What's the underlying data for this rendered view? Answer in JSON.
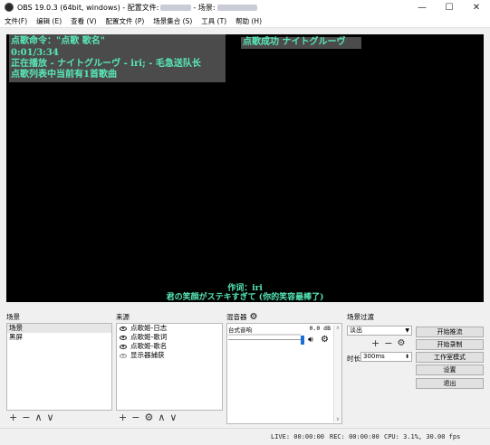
{
  "window": {
    "title_prefix": "OBS 19.0.3 (64bit, windows) - 配置文件:",
    "title_scene_label": "- 场景:",
    "controls": [
      "—",
      "☐",
      "✕"
    ]
  },
  "menu": [
    "文件(F)",
    "编辑 (E)",
    "查看 (V)",
    "配置文件 (P)",
    "场景集合 (S)",
    "工具 (T)",
    "帮助 (H)"
  ],
  "preview": {
    "command_line": "点歌命令：\"点歌 歌名\"",
    "success_line": "点歌成功 ナイトグルーヴ",
    "time_line": "0:01/3:34",
    "playing_line": "正在播放 - ナイトグルーヴ - iri; - 毛急送队长",
    "queue_line": "点歌列表中当前有1首歌曲",
    "lyric_credit": "作词：iri",
    "lyric_line": "君の笑顔がステキすぎて (你的笑容最棒了)"
  },
  "scenes": {
    "label": "场景",
    "items": [
      "场景",
      "黑屏"
    ]
  },
  "sources": {
    "label": "来源",
    "items": [
      "点歌姬-日志",
      "点歌姬-歌词",
      "点歌姬-歌名",
      "显示器捕获"
    ]
  },
  "mixer": {
    "label": "混音器",
    "track_name": "台式音响",
    "db_value": "0.0 dB"
  },
  "transitions": {
    "label": "场景过渡",
    "selected": "淡出",
    "duration_label": "时长",
    "duration_value": "300ms"
  },
  "controls": {
    "start_stream": "开始推流",
    "start_record": "开始录制",
    "studio_mode": "工作室模式",
    "settings": "设置",
    "exit": "退出"
  },
  "status": {
    "live": "LIVE: 00:00:00",
    "rec": "REC: 00:00:00",
    "cpu": "CPU: 3.1%, 30.00 fps"
  },
  "colors": {
    "overlay_text": "#58e8b8",
    "overlay_bg": "#4b4b4b",
    "meter_blue": "#1e6fd9"
  }
}
